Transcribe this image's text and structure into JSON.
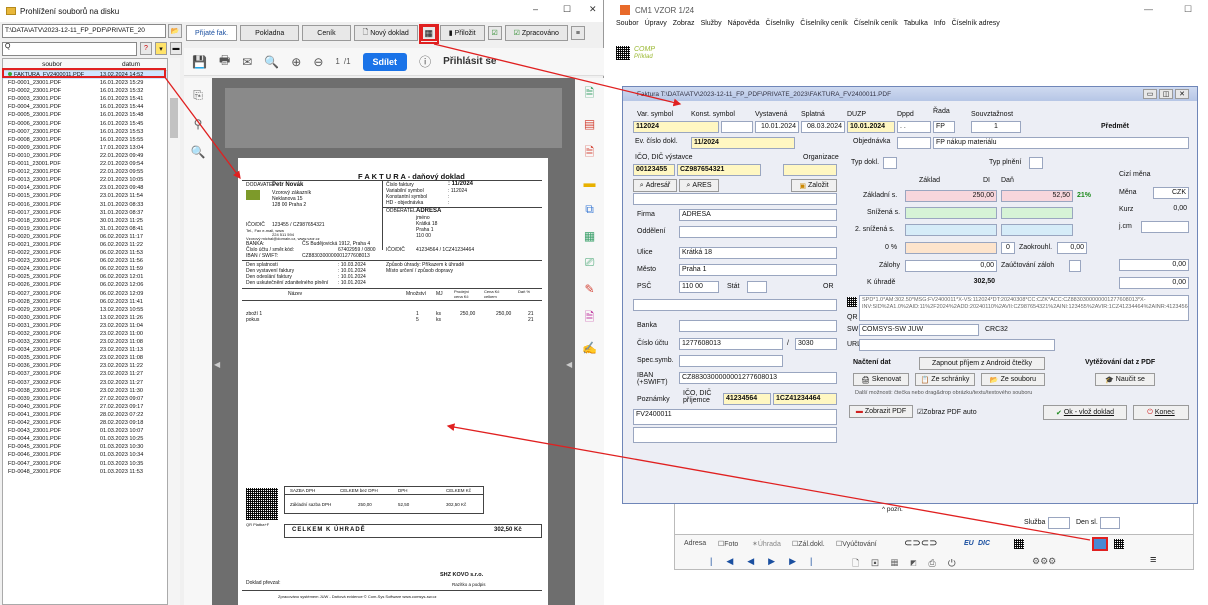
{
  "left_window": {
    "title": "Prohlížení souborů na disku",
    "window_controls": [
      "–",
      "☐",
      "✕"
    ],
    "path": "T:\\DATA\\ATV\\2023-12-11_FP_PDF\\PRIVATE_20",
    "search_placeholder": "Q",
    "file_list": {
      "headers": [
        "soubor",
        "datum"
      ],
      "rows": [
        [
          "FAKTURA_FV2400011.PDF",
          "13.02.2024 14:52"
        ],
        [
          "FD-0001_23001.PDF",
          "16.01.2023 15:29"
        ],
        [
          "FD-0002_23001.PDF",
          "16.01.2023 15:32"
        ],
        [
          "FD-0003_23001.PDF",
          "16.01.2023 15:41"
        ],
        [
          "FD-0004_23001.PDF",
          "16.01.2023 15:44"
        ],
        [
          "FD-0005_23001.PDF",
          "16.01.2023 15:48"
        ],
        [
          "FD-0006_23001.PDF",
          "16.01.2023 15:45"
        ],
        [
          "FD-0007_23001.PDF",
          "16.01.2023 15:53"
        ],
        [
          "FD-0008_23001.PDF",
          "16.01.2023 15:55"
        ],
        [
          "FD-0009_23001.PDF",
          "17.01.2023 13:04"
        ],
        [
          "FD-0010_23001.PDF",
          "22.01.2023 09:49"
        ],
        [
          "FD-0011_23001.PDF",
          "22.01.2023 09:54"
        ],
        [
          "FD-0012_23001.PDF",
          "22.01.2023 09:55"
        ],
        [
          "FD-0013_23001.PDF",
          "22.01.2023 10:05"
        ],
        [
          "FD-0014_23001.PDF",
          "23.01.2023 09:48"
        ],
        [
          "FD-0015_23001.PDF",
          "23.01.2023 11:54"
        ],
        [
          "FD-0016_23001.PDF",
          "31.01.2023 08:33"
        ],
        [
          "FD-0017_23001.PDF",
          "31.01.2023 08:37"
        ],
        [
          "FD-0018_23001.PDF",
          "30.01.2023 11:25"
        ],
        [
          "FD-0019_23001.PDF",
          "31.01.2023 08:41"
        ],
        [
          "FD-0020_23001.PDF",
          "06.02.2023 11:17"
        ],
        [
          "FD-0021_23001.PDF",
          "06.02.2023 11:22"
        ],
        [
          "FD-0022_23001.PDF",
          "06.02.2023 11:53"
        ],
        [
          "FD-0023_23001.PDF",
          "06.02.2023 11:56"
        ],
        [
          "FD-0024_23001.PDF",
          "06.02.2023 11:59"
        ],
        [
          "FD-0025_23001.PDF",
          "06.02.2023 12:01"
        ],
        [
          "FD-0026_23001.PDF",
          "06.02.2023 12:06"
        ],
        [
          "FD-0027_23001.PDF",
          "06.02.2023 12:09"
        ],
        [
          "FD-0028_23001.PDF",
          "06.02.2023 11:41"
        ],
        [
          "FD-0029_23001.PDF",
          "13.02.2023 10:55"
        ],
        [
          "FD-0030_23001.PDF",
          "13.02.2023 11:26"
        ],
        [
          "FD-0031_23001.PDF",
          "23.02.2023 11:04"
        ],
        [
          "FD-0032_23001.PDF",
          "23.02.2023 11:00"
        ],
        [
          "FD-0033_23001.PDF",
          "23.02.2023 11:08"
        ],
        [
          "FD-0034_23001.PDF",
          "23.02.2023 11:13"
        ],
        [
          "FD-0035_23001.PDF",
          "23.02.2023 11:08"
        ],
        [
          "FD-0036_23001.PDF",
          "23.02.2023 11:22"
        ],
        [
          "FD-0037_23001.PDF",
          "23.02.2023 11:27"
        ],
        [
          "FD-0037_23002.PDF",
          "23.02.2023 11:27"
        ],
        [
          "FD-0038_23001.PDF",
          "23.02.2023 11:30"
        ],
        [
          "FD-0039_23001.PDF",
          "27.02.2023 09:07"
        ],
        [
          "FD-0040_23001.PDF",
          "27.02.2023 09:17"
        ],
        [
          "FD-0041_23001.PDF",
          "28.02.2023 07:22"
        ],
        [
          "FD-0042_23001.PDF",
          "28.02.2023 09:18"
        ],
        [
          "FD-0043_23001.PDF",
          "01.03.2023 10:07"
        ],
        [
          "FD-0044_23001.PDF",
          "01.03.2023 10:25"
        ],
        [
          "FD-0045_23001.PDF",
          "01.03.2023 10:30"
        ],
        [
          "FD-0046_23001.PDF",
          "01.03.2023 10:34"
        ],
        [
          "FD-0047_23001.PDF",
          "01.03.2023 10:35"
        ],
        [
          "FD-0048_23001.PDF",
          "01.03.2023 11:53"
        ]
      ]
    },
    "tabs": {
      "prijate": "Přijaté fak.",
      "pokladna": "Pokladna",
      "cenik": "Ceník",
      "novy_doklad": "Nový doklad",
      "prilozit": "Přiložit",
      "zpracovano": "Zpracováno"
    },
    "pdf_toolbar": {
      "page_current": "1",
      "page_total": "/1",
      "share": "Sdílet",
      "signin": "Přihlásit se"
    }
  },
  "pdf_doc": {
    "title": "F A K T U R A - daňový doklad",
    "dodavatel_label": "DODAVATEL",
    "dodavatel_name": "Petr Novák",
    "dodavatel_addr": [
      "Vzorový zákazník",
      "Neklanova 15",
      "128 00 Praha 2"
    ],
    "meta_labels": [
      "Číslo faktury",
      "Variabilní symbol",
      "Konstantní symbol",
      "HD - objednávka"
    ],
    "meta_values": [
      ": 11/2024",
      ": 112024",
      ":",
      ":"
    ],
    "odberatel_label": "ODBĚRATEL",
    "odberatel_name": "ADRESA",
    "odberatel_addr": [
      "jméno",
      "Krátká 18",
      "Praha 1",
      "110 00"
    ],
    "ico_label": "IČO/DIČ",
    "ico_value": "123455 / CZ987654321",
    "contact_lines": [
      "Tel., Fax e-mail, www",
      "224 511 594",
      "Vzorový michal@domain.cz, www.vzor.cz"
    ],
    "banka_label": "BANKA:",
    "banka_value": "ČS Budějovická 1912, Praha 4",
    "ucet_label": "Číslo účtu / směr.kód:",
    "ucet_value": "67402959 / 0800",
    "iban_label": "IBAN / SWIFT:",
    "iban_value": "CZ8830300000001277608013",
    "odb_ico_label": "IČO/DIČ",
    "odb_ico_value": "41234564 / 1CZ41234464",
    "zpusob": [
      "Způsob úhrady: Příkazem k úhradě",
      "Místo určení / způsob dopravy"
    ],
    "dates_labels": [
      "Den splatnosti",
      "Den vystavení faktury",
      "Den odeslání faktury",
      "Den uskutečnění zdanitelného plnění"
    ],
    "dates_values": [
      ": 10.03.2024",
      ": 10.01.2024",
      ": 10.01.2024",
      ": 10.01.2024"
    ],
    "items_headers": [
      "Název",
      "Množství",
      "MJ",
      "Prodejní cena Kč",
      "Cena Kč celkem",
      "Daň %"
    ],
    "items": [
      [
        "zboží 1",
        "1",
        "ks",
        "250,00",
        "250,00",
        "21"
      ],
      [
        "pokus",
        "5",
        "ks",
        "",
        "",
        "21"
      ]
    ],
    "tax_headers": [
      "SAZBA DPH",
      "CELKEM bez DPH",
      "DPH",
      "CELKEM Kč"
    ],
    "tax_row": [
      "Základní sazba DPH",
      "250,00",
      "52,50",
      "302,50 Kč"
    ],
    "total_label": "CELKEM K ÚHRADĚ",
    "total_value": "302,50 Kč",
    "qr_caption": "QR Platba+F",
    "doklad_prevzal": "Doklad převzal:",
    "stamp_line1": "SHZ KOVO s.r.o.",
    "stamp_line2": "Razítko a podpis",
    "footer": "Zpracováno systémem JUW - Daňová evidence   © Com-Sys Software   www.comsys-sw.cz"
  },
  "right_window": {
    "title": "CM1 VZOR 1/24",
    "window_controls": [
      "—",
      "☐"
    ],
    "menu": [
      "Soubor",
      "Úpravy",
      "Zobraz",
      "Služby",
      "Nápověda",
      "Číselníky",
      "Číselníky ceník",
      "Číselník ceník",
      "Tabulka",
      "Info",
      "Číselník adresy"
    ],
    "logo_text": "COMP",
    "logo_sub": "Příklad"
  },
  "dialog": {
    "title": "Faktura T:\\DATA\\ATV\\2023-12-11_FP_PDF\\PRIVATE_2023\\FAKTURA_FV2400011.PDF",
    "labels": {
      "var_symbol": "Var. symbol",
      "konst_symbol": "Konst. symbol",
      "vystavena": "Vystavená",
      "splatna": "Splatná",
      "duzp": "DUZP",
      "dppd": "Dppd",
      "rada": "Řada",
      "souvztaznost": "Souvztažnost",
      "predmet": "Předmět",
      "ev_cislo": "Ev. číslo dokl.",
      "objednavka": "Objednávka",
      "ico_dic_vystavce": "IČO, DIČ výstavce",
      "organizace": "Organizace",
      "adresar": "Adresář",
      "ares": "ARES",
      "zalozit": "Založit",
      "typ_dokl": "Typ dokl.",
      "typ_plneni": "Typ plnění",
      "zaklad": "Základ",
      "di": "DI",
      "dan": "Daň",
      "cizi_mena": "Cizí měna",
      "zakladni_s": "Základní s.",
      "snizena_s": "Snížená s.",
      "snizena2_s": "2. snížená s.",
      "nula": "0 %",
      "zalohy": "Zálohy",
      "k_uhrade": "K úhradě",
      "mena": "Měna",
      "kurz": "Kurz",
      "jcm": "j.cm",
      "zaokrouhl": "Zaokrouhl.",
      "zauctovani_zaloh": "Zaúčtování záloh",
      "firma": "Firma",
      "oddeleni": "Oddělení",
      "ulice": "Ulice",
      "mesto": "Město",
      "psc": "PSČ",
      "stat": "Stát",
      "or": "OR",
      "banka": "Banka",
      "cislo_uctu": "Číslo účtu",
      "spec_symb": "Spec.symb.",
      "iban": "IBAN (+SWIFT)",
      "ico_dic_prijemce": "IČO, DIČ příjemce",
      "poznamky": "Poznámky",
      "qr": "QR",
      "sw": "SW",
      "crc": "CRC32",
      "url": "URL",
      "nacteni_dat": "Načtení dat",
      "zapnout_android": "Zapnout příjem z Android čtečky",
      "vytezovani": "Vytěžování dat z PDF",
      "skenovat": "Skenovat",
      "ze_schranky": "Ze schránky",
      "ze_souboru": "Ze souboru",
      "naucit_se": "Naučit se",
      "dalsi_moznosti": "Další možnosti: čtečka nebo drag&drop obrázku/textu/textového souboru",
      "zobrazit_pdf": "Zobrazit PDF",
      "zobraz_pdf_auto": "Zobraz PDF auto",
      "ok": "Ok - vlož doklad",
      "konec": "Konec"
    },
    "values": {
      "var_symbol": "112024",
      "vystavena": "10.01.2024",
      "splatna": "08.03.2024",
      "duzp": "10.01.2024",
      "dppd": ". .",
      "rada": "FP",
      "souvztaznost": "1",
      "ev_cislo": "11/2024",
      "predmet": "FP nákup materiálu",
      "ico": "00123455",
      "dic": "CZ987654321",
      "zakladni_zaklad": "250,00",
      "zakladni_dan": "52,50",
      "zakladni_pct": "21%",
      "zaokrouhl_val": "0,00",
      "zaokrouhl_num": "0",
      "zalohy": "0,00",
      "k_uhrade": "302,50",
      "mena": "CZK",
      "kurz": "0,00",
      "right_zero1": "0,00",
      "right_zero2": "0,00",
      "firma": "ADRESA",
      "ulice": "Krátká 18",
      "mesto": "Praha 1",
      "psc": "110 00",
      "cislo_uctu": "1277608013",
      "kod_banky": "3030",
      "iban": "CZ8830300000001277608013",
      "prij_ico": "41234564",
      "prij_dic": "1CZ41234464",
      "poznamka": "FV2400011",
      "qr_text": "SPD*1.0*AM:302.50*MSG:FV2400011*X-VS:112024*DT:20240308*CC:CZK*ACC:CZ8830300000001277608013*X-INV:SID%2A1.0%2AID:11%2F2024%2ADD:20240110%2AVII:CZ987654321%2AINI:123455%2AVIR:1CZ41234464%2AINR:41234564%2ADUZP:20240110%2ATB0:250.00%2AT0:52",
      "sw": "COMSYS-SW JUW"
    }
  },
  "bottom": {
    "pozn": "pozn.",
    "sluzba": "Služba",
    "den_sl": "Den sl.",
    "toolbar": [
      "Adresa",
      "Foto",
      "Úhrada",
      "Zál.dokl.",
      "Vyúčtování",
      "EU",
      "DIC"
    ]
  }
}
